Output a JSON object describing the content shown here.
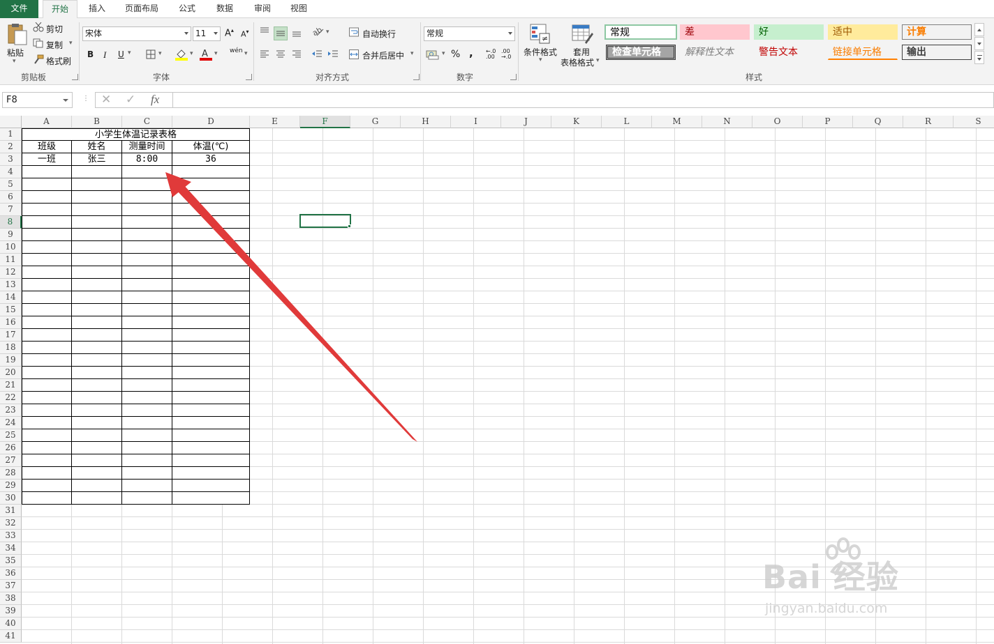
{
  "tabs": [
    "文件",
    "开始",
    "插入",
    "页面布局",
    "公式",
    "数据",
    "审阅",
    "视图"
  ],
  "ribbon": {
    "clipboard": {
      "paste": "粘贴",
      "cut": "剪切",
      "copy": "复制",
      "format_painter": "格式刷",
      "label": "剪贴板"
    },
    "font": {
      "name": "宋体",
      "size": "11",
      "bold": "B",
      "italic": "I",
      "underline": "U",
      "label": "字体",
      "grow": "A",
      "shrink": "A",
      "phonetic": "wén"
    },
    "alignment": {
      "wrap": "自动换行",
      "merge": "合并后居中",
      "label": "对齐方式"
    },
    "number": {
      "format": "常规",
      "percent": "%",
      "comma": ",",
      "inc_decimal": "←.0 .00",
      "dec_decimal": ".00 →.0",
      "label": "数字"
    },
    "styles": {
      "conditional": "条件格式",
      "table_fmt_1": "套用",
      "table_fmt_2": "表格格式",
      "cells": [
        "常规",
        "差",
        "好",
        "适中",
        "计算",
        "检查单元格",
        "解释性文本",
        "警告文本",
        "链接单元格",
        "输出"
      ],
      "label": "样式"
    }
  },
  "formula_bar": {
    "name_box": "F8",
    "fx": "fx",
    "cancel": "✕",
    "enter": "✓",
    "content": ""
  },
  "sheet": {
    "columns": [
      "A",
      "B",
      "C",
      "D",
      "E",
      "F",
      "G",
      "H",
      "I",
      "J",
      "K",
      "L",
      "M",
      "N",
      "O",
      "P",
      "Q",
      "R",
      "S"
    ],
    "selected_cell": "F8",
    "title": "小学生体温记录表格",
    "headers": [
      "班级",
      "姓名",
      "测量时间",
      "体温(℃)"
    ],
    "rows": [
      [
        "一班",
        "张三",
        "8:00",
        "36"
      ]
    ]
  },
  "watermark": {
    "text": "Bai 经验",
    "url": "jingyan.baidu.com"
  }
}
